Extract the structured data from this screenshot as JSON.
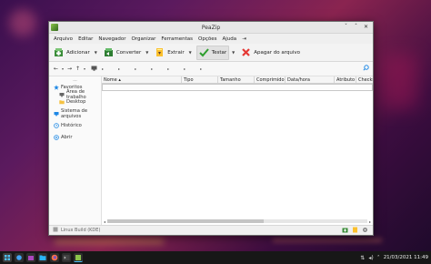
{
  "window": {
    "title": "PeaZip",
    "minimize_glyph": "ˇ",
    "maximize_glyph": "ˆ",
    "close_glyph": "✕"
  },
  "menu": [
    "Arquivo",
    "Editar",
    "Navegador",
    "Organizar",
    "Ferramentas",
    "Opções",
    "Ajuda",
    "⇥"
  ],
  "toolbar": {
    "add_label": "Adicionar",
    "convert_label": "Converter",
    "extract_label": "Extrair",
    "test_label": "Testar",
    "delete_label": "Apagar do arquivo",
    "dropdown_glyph": "▼"
  },
  "addressbar": {
    "back": "←",
    "forward": "→",
    "up": "↑",
    "more": "▾",
    "breadcrumb_arrow": "▸"
  },
  "sidebar": {
    "dots": "...",
    "favorites_label": "Favoritos",
    "desktop_area_label": "Área de trabalho",
    "desktop_label": "Desktop",
    "filesystem_label": "Sistema de arquivos",
    "history_label": "Histórico",
    "open_label": "Abrir"
  },
  "columns": [
    {
      "label": "Nome ▴",
      "width": 88
    },
    {
      "label": "Tipo",
      "width": 40
    },
    {
      "label": "Tamanho",
      "width": 40
    },
    {
      "label": "Comprimido",
      "width": 34
    },
    {
      "label": "Data/hora",
      "width": 54
    },
    {
      "label": "Atributo",
      "width": 24
    },
    {
      "label": "Checksum",
      "width": 18
    }
  ],
  "statusbar": {
    "text": "Linux Build (KDE)"
  },
  "taskbar": {
    "clock": "21/03/2021 11:49"
  },
  "colors": {
    "accent_green": "#4caf50",
    "delete_red": "#e53935",
    "favorites_star": "#1e88e5",
    "folder_yellow": "#f5c242"
  }
}
